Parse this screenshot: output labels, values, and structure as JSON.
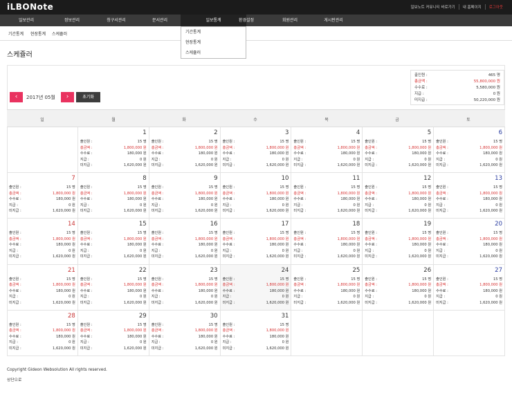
{
  "app": {
    "logo": "iLBONote",
    "top_links": [
      "일보노트 커뮤니티 바로가기",
      "내 홈페이지",
      "로그아웃"
    ]
  },
  "nav": {
    "items": [
      "일보관리",
      "정보관리",
      "청구서관리",
      "문서관리",
      "일보통계",
      "환경설정",
      "회원관리",
      "게시판관리"
    ],
    "active_index": 4
  },
  "dropdown": {
    "items": [
      "기간통계",
      "현장통계",
      "스케쥴러"
    ]
  },
  "subnav": {
    "items": [
      "기간통계",
      "현장통계",
      "스케쥴러"
    ]
  },
  "page_title": "스케쥴러",
  "summary": {
    "rows": [
      {
        "label": "출인원 :",
        "value": "465 명",
        "red": false
      },
      {
        "label": "총금액 :",
        "value": "55,800,000 원",
        "red": true
      },
      {
        "label": "수수료 :",
        "value": "5,580,000 원",
        "red": false
      },
      {
        "label": "지급 :",
        "value": "0 원",
        "red": false
      },
      {
        "label": "미지급 :",
        "value": "50,220,000 원",
        "red": false
      }
    ]
  },
  "controls": {
    "prev_icon": "‹",
    "next_icon": "›",
    "month_label": "2017년 05월",
    "reset_label": "초기화"
  },
  "calendar": {
    "weekdays": [
      "일",
      "월",
      "화",
      "수",
      "목",
      "금",
      "토"
    ],
    "first_weekday": 1,
    "days_in_month": 31,
    "today": 24,
    "day_stats": [
      {
        "label": "출인원 :",
        "value": "15 명",
        "red": false
      },
      {
        "label": "총금액 :",
        "value": "1,800,000 원",
        "red": true
      },
      {
        "label": "수수료 :",
        "value": "180,000 원",
        "red": false
      },
      {
        "label": "지급 :",
        "value": "0 원",
        "red": false
      },
      {
        "label": "미지급 :",
        "value": "1,620,000 원",
        "red": false
      }
    ]
  },
  "footer": {
    "copyright": "Copyright Gideon Websolution All rights reserved.",
    "top_link": "상단으로"
  },
  "colors": {
    "accent": "#e9325f",
    "sunday": "#c83232",
    "saturday": "#2a3da0",
    "money_red": "#d63030"
  }
}
